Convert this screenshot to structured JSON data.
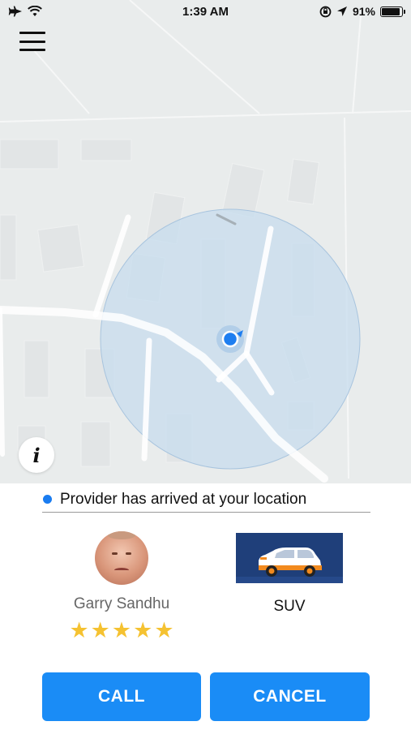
{
  "status_bar": {
    "time": "1:39 AM",
    "battery_percent": "91%",
    "battery_level": 0.91
  },
  "icons": {
    "airplane": "airplane-icon",
    "wifi": "wifi-icon",
    "lock_rotation": "lock-rotation-icon",
    "location_arrow": "location-arrow-icon",
    "menu": "hamburger-menu-icon",
    "info": "info-icon"
  },
  "map": {
    "info_label": "i"
  },
  "trip": {
    "status_message": "Provider has arrived at your location",
    "status_dot_color": "#1a7cf0"
  },
  "provider": {
    "name": "Garry Sandhu",
    "rating": 5,
    "star_color": "#f5c231",
    "stars": [
      "★",
      "★",
      "★",
      "★",
      "★"
    ]
  },
  "vehicle": {
    "type": "SUV"
  },
  "actions": {
    "call_label": "CALL",
    "cancel_label": "CANCEL",
    "button_color": "#1a8cf6"
  }
}
